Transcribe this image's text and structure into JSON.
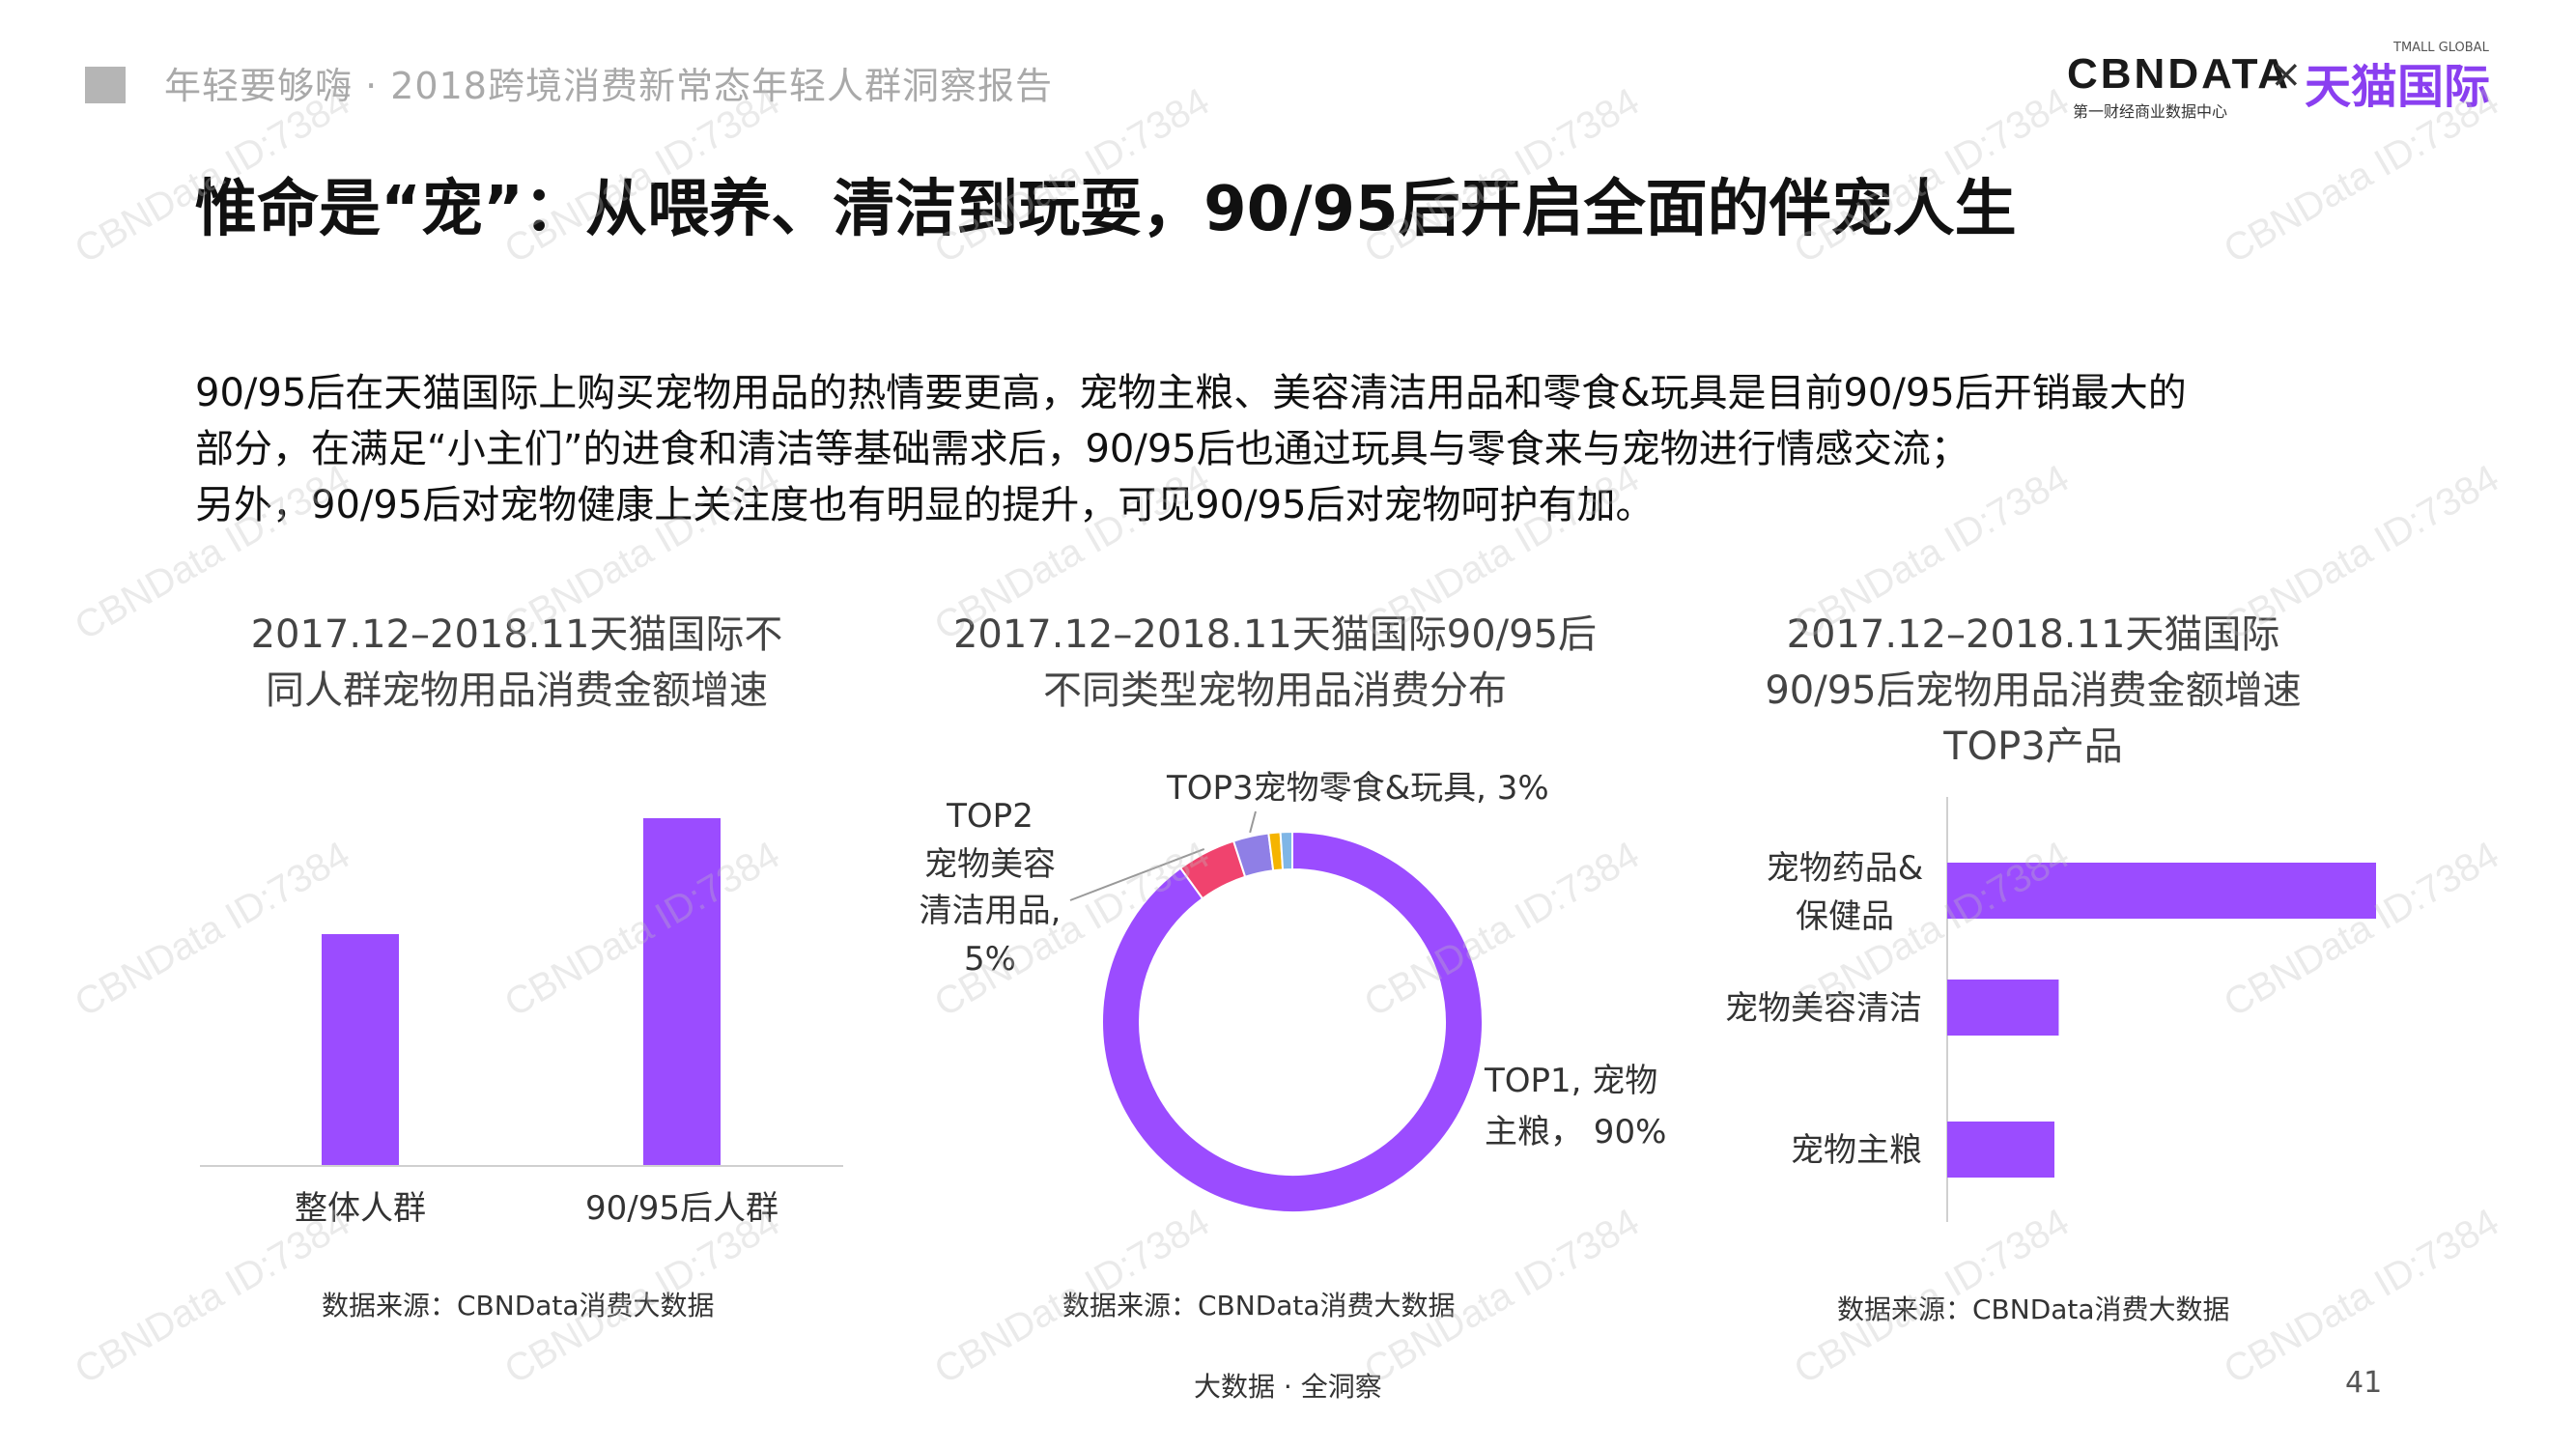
{
  "header": {
    "report_title": "年轻要够嗨 · 2018跨境消费新常态年轻人群洞察报告",
    "logo_cbndata": "CBNDATA",
    "logo_cbndata_sub": "第一财经商业数据中心",
    "logo_separator": "×",
    "logo_tmall": "天猫国际",
    "logo_tmall_small": "TMALL GLOBAL"
  },
  "slide_title": "惟命是“宠”：从喂养、清洁到玩耍，90/95后开启全面的伴宠人生",
  "intro_lines": [
    "90/95后在天猫国际上购买宠物用品的热情要更高，宠物主粮、美容清洁用品和零食&玩具是目前90/95后开销最大的",
    "部分，在满足“小主们”的进食和清洁等基础需求后，90/95后也通过玩具与零食来与宠物进行情感交流；",
    "另外，90/95后对宠物健康上关注度也有明显的提升，可见90/95后对宠物呵护有加。"
  ],
  "chart_data": [
    {
      "type": "bar",
      "title_lines": [
        "2017.12–2018.11天猫国际不",
        "同人群宠物用品消费金额增速"
      ],
      "categories": [
        "整体人群",
        "90/95后人群"
      ],
      "values": [
        0.6,
        0.9
      ],
      "ylim": [
        0,
        1
      ],
      "color": "#9b4cff",
      "source": "数据来源：CBNData消费大数据"
    },
    {
      "type": "pie",
      "title_lines": [
        "2017.12–2018.11天猫国际90/95后",
        "不同类型宠物用品消费分布"
      ],
      "slices": [
        {
          "label_lines": [
            "TOP1, 宠物",
            "主粮， 90%"
          ],
          "value": 90,
          "color": "#9b4cff"
        },
        {
          "label_lines": [
            "TOP2",
            "宠物美容",
            "清洁用品,",
            "5%"
          ],
          "value": 5,
          "color": "#f0436e"
        },
        {
          "label_lines": [
            "TOP3宠物零食&玩具, 3%"
          ],
          "value": 3,
          "color": "#8f7fe6"
        },
        {
          "value": 1,
          "color": "#f5b400"
        },
        {
          "value": 1,
          "color": "#7fb6e6"
        }
      ],
      "source": "数据来源：CBNData消费大数据"
    },
    {
      "type": "bar",
      "orientation": "horizontal",
      "title_lines": [
        "2017.12–2018.11天猫国际",
        "90/95后宠物用品消费金额增速",
        "TOP3产品"
      ],
      "categories": [
        {
          "label_lines": [
            "宠物药品&",
            "保健品"
          ]
        },
        {
          "label_lines": [
            "宠物美容清洁"
          ]
        },
        {
          "label_lines": [
            "宠物主粮"
          ]
        }
      ],
      "values": [
        1.0,
        0.26,
        0.25
      ],
      "xlim": [
        0,
        1
      ],
      "color": "#9b4cff",
      "source": "数据来源：CBNData消费大数据"
    }
  ],
  "footer": {
    "tagline": "大数据 · 全洞察",
    "page_number": "41"
  },
  "watermark": "CBNData ID:7384"
}
